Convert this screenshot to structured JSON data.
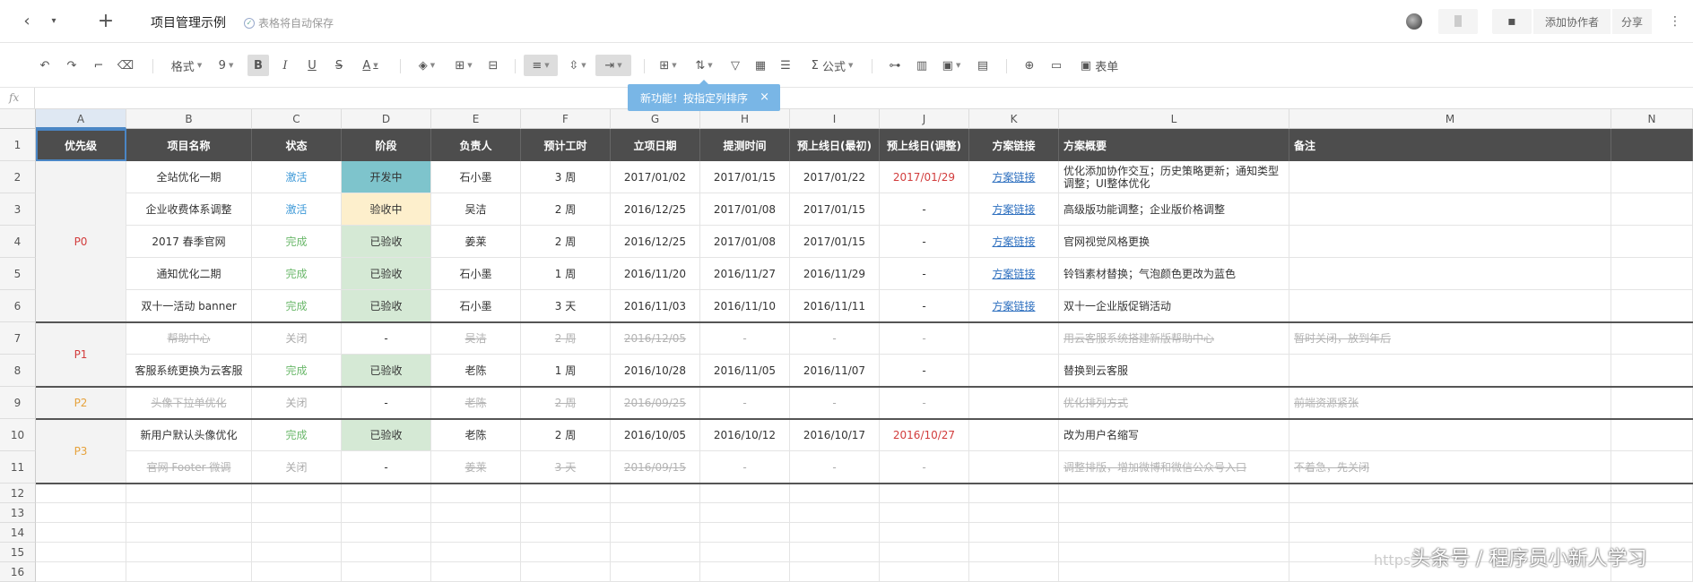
{
  "titlebar": {
    "title": "项目管理示例",
    "save_status": "表格将自动保存",
    "add_collaborator": "添加协作者",
    "share": "分享"
  },
  "toolbar": {
    "format_label": "格式",
    "font_size": "9",
    "bold": "B",
    "italic": "I",
    "underline": "U",
    "strike": "S",
    "font_color": "A",
    "formula_label": "公式",
    "form_label": "表单"
  },
  "tooltip": {
    "text": "新功能！按指定列排序",
    "close": "×"
  },
  "formula_bar": {
    "fx": "fx"
  },
  "columns": [
    "A",
    "B",
    "C",
    "D",
    "E",
    "F",
    "G",
    "H",
    "I",
    "J",
    "K",
    "L",
    "M",
    "N"
  ],
  "header_row": [
    "优先级",
    "项目名称",
    "状态",
    "阶段",
    "负责人",
    "预计工时",
    "立项日期",
    "提测时间",
    "预上线日(最初)",
    "预上线日(调整)",
    "方案链接",
    "方案概要",
    "备注",
    ""
  ],
  "row_numbers": [
    "1",
    "2",
    "3",
    "4",
    "5",
    "6",
    "7",
    "8",
    "9",
    "10",
    "11",
    "12",
    "13",
    "14",
    "15",
    "16"
  ],
  "priority": {
    "p0": "P0",
    "p1": "P1",
    "p2": "P2",
    "p3": "P3"
  },
  "rows": [
    {
      "name": "全站优化一期",
      "status": "激活",
      "phase": "开发中",
      "owner": "石小墨",
      "hours": "3 周",
      "start": "2017/01/02",
      "test": "2017/01/15",
      "launch": "2017/01/22",
      "adjusted": "2017/01/29",
      "link": "方案链接",
      "summary": "优化添加协作交互；历史策略更新；通知类型调整；UI整体优化",
      "note": ""
    },
    {
      "name": "企业收费体系调整",
      "status": "激活",
      "phase": "验收中",
      "owner": "吴洁",
      "hours": "2 周",
      "start": "2016/12/25",
      "test": "2017/01/08",
      "launch": "2017/01/15",
      "adjusted": "-",
      "link": "方案链接",
      "summary": "高级版功能调整；企业版价格调整",
      "note": ""
    },
    {
      "name": "2017 春季官网",
      "status": "完成",
      "phase": "已验收",
      "owner": "姜莱",
      "hours": "2 周",
      "start": "2016/12/25",
      "test": "2017/01/08",
      "launch": "2017/01/15",
      "adjusted": "-",
      "link": "方案链接",
      "summary": "官网视觉风格更换",
      "note": ""
    },
    {
      "name": "通知优化二期",
      "status": "完成",
      "phase": "已验收",
      "owner": "石小墨",
      "hours": "1 周",
      "start": "2016/11/20",
      "test": "2016/11/27",
      "launch": "2016/11/29",
      "adjusted": "-",
      "link": "方案链接",
      "summary": "铃铛素材替换；气泡颜色更改为蓝色",
      "note": ""
    },
    {
      "name": "双十一活动 banner",
      "status": "完成",
      "phase": "已验收",
      "owner": "石小墨",
      "hours": "3 天",
      "start": "2016/11/03",
      "test": "2016/11/10",
      "launch": "2016/11/11",
      "adjusted": "-",
      "link": "方案链接",
      "summary": "双十一企业版促销活动",
      "note": ""
    },
    {
      "name": "帮助中心",
      "status": "关闭",
      "phase": "-",
      "owner": "吴洁",
      "hours": "2 周",
      "start": "2016/12/05",
      "test": "-",
      "launch": "-",
      "adjusted": "-",
      "link": "",
      "summary": "用云客服系统搭建新版帮助中心",
      "note": "暂时关闭，放到年后"
    },
    {
      "name": "客服系统更换为云客服",
      "status": "完成",
      "phase": "已验收",
      "owner": "老陈",
      "hours": "1 周",
      "start": "2016/10/28",
      "test": "2016/11/05",
      "launch": "2016/11/07",
      "adjusted": "-",
      "link": "",
      "summary": "替换到云客服",
      "note": ""
    },
    {
      "name": "头像下拉单优化",
      "status": "关闭",
      "phase": "-",
      "owner": "老陈",
      "hours": "2 周",
      "start": "2016/09/25",
      "test": "-",
      "launch": "-",
      "adjusted": "-",
      "link": "",
      "summary": "优化排列方式",
      "note": "前端资源紧张"
    },
    {
      "name": "新用户默认头像优化",
      "status": "完成",
      "phase": "已验收",
      "owner": "老陈",
      "hours": "2 周",
      "start": "2016/10/05",
      "test": "2016/10/12",
      "launch": "2016/10/17",
      "adjusted": "2016/10/27",
      "link": "",
      "summary": "改为用户名缩写",
      "note": ""
    },
    {
      "name": "官网 Footer 微调",
      "status": "关闭",
      "phase": "-",
      "owner": "姜莱",
      "hours": "3 天",
      "start": "2016/09/15",
      "test": "-",
      "launch": "-",
      "adjusted": "-",
      "link": "",
      "summary": "调整排版，增加微博和微信公众号入口",
      "note": "不着急，先关闭"
    }
  ],
  "watermark": {
    "prefix": "https",
    "text": "头条号 / 程序员小新人学习"
  },
  "colors": {
    "header_bg": "#4d4d4d",
    "dev": "#7ec4cc",
    "checking": "#fdefcc",
    "done": "#d5e9d5",
    "accent": "#4a86c5"
  }
}
